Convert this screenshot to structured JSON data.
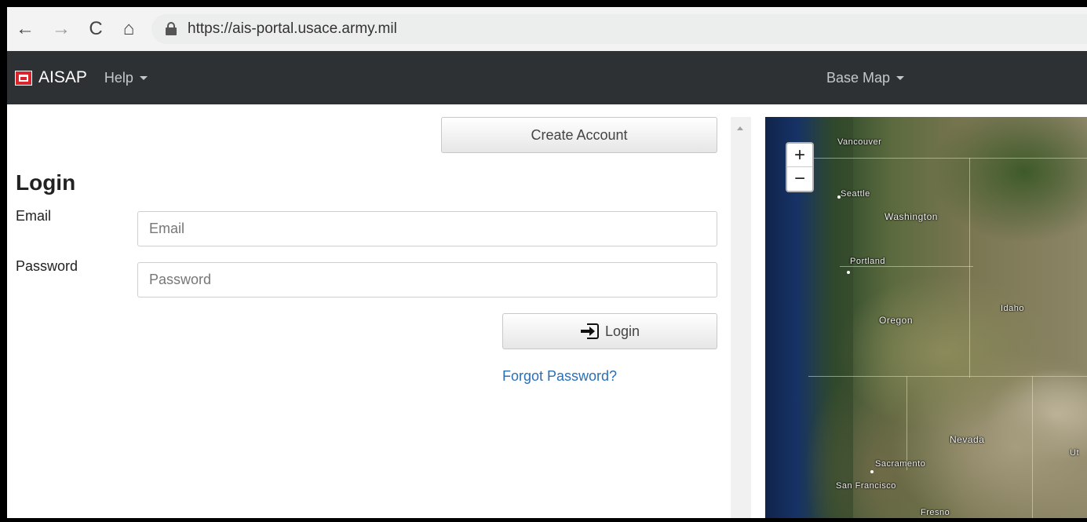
{
  "browser": {
    "url": "https://ais-portal.usace.army.mil"
  },
  "navbar": {
    "brand": "AISAP",
    "help_label": "Help",
    "basemap_label": "Base Map"
  },
  "login": {
    "create_account_label": "Create Account",
    "title": "Login",
    "email_label": "Email",
    "email_placeholder": "Email",
    "password_label": "Password",
    "password_placeholder": "Password",
    "login_button_label": "Login",
    "forgot_password_label": "Forgot Password?"
  },
  "map": {
    "zoom_in": "+",
    "zoom_out": "−",
    "labels": {
      "vancouver": "Vancouver",
      "seattle": "Seattle",
      "washington": "Washington",
      "portland": "Portland",
      "idaho": "Idaho",
      "oregon": "Oregon",
      "nevada": "Nevada",
      "sacramento": "Sacramento",
      "san_francisco": "San Francisco",
      "utah_partial": "Ut",
      "fresno_partial": "Fresno"
    }
  }
}
